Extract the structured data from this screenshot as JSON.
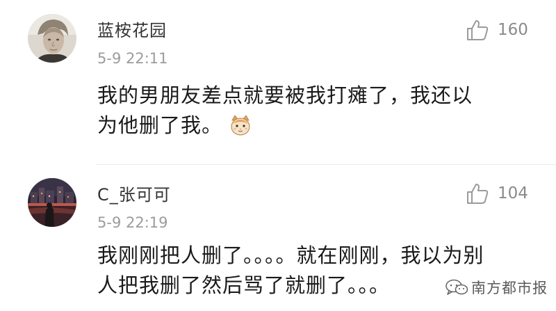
{
  "comments": [
    {
      "username": "蓝桉花园",
      "time": "5-9 22:11",
      "likes": "160",
      "lines": [
        "我的男朋友差点就要被我打瘫了，我还以",
        "为他删了我。"
      ],
      "avatar_icon": "portrait-avatar",
      "emoji_icon": "cat-face-emoji"
    },
    {
      "username": "C_张可可",
      "time": "5-9 22:19",
      "likes": "104",
      "lines": [
        "我刚刚把人删了。。。。就在刚刚，我以为别",
        "人把我删了然后骂了就删了。。。"
      ],
      "avatar_icon": "night-city-avatar"
    }
  ],
  "watermark": {
    "text": "南方都市报",
    "icon": "wechat-icon"
  },
  "colors": {
    "text": "#1a1a1a",
    "username": "#333333",
    "meta": "#9c9c9c",
    "like": "#8a8a8a",
    "divider": "#e9e9e9"
  }
}
